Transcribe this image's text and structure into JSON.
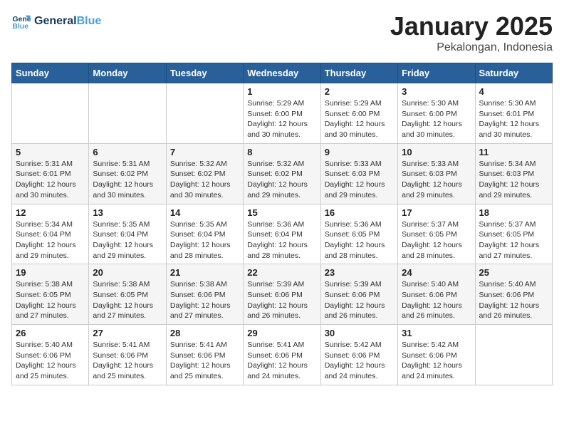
{
  "header": {
    "logo_line1": "General",
    "logo_line2": "Blue",
    "month": "January 2025",
    "location": "Pekalongan, Indonesia"
  },
  "weekdays": [
    "Sunday",
    "Monday",
    "Tuesday",
    "Wednesday",
    "Thursday",
    "Friday",
    "Saturday"
  ],
  "weeks": [
    [
      {
        "day": "",
        "info": ""
      },
      {
        "day": "",
        "info": ""
      },
      {
        "day": "",
        "info": ""
      },
      {
        "day": "1",
        "info": "Sunrise: 5:29 AM\nSunset: 6:00 PM\nDaylight: 12 hours\nand 30 minutes."
      },
      {
        "day": "2",
        "info": "Sunrise: 5:29 AM\nSunset: 6:00 PM\nDaylight: 12 hours\nand 30 minutes."
      },
      {
        "day": "3",
        "info": "Sunrise: 5:30 AM\nSunset: 6:00 PM\nDaylight: 12 hours\nand 30 minutes."
      },
      {
        "day": "4",
        "info": "Sunrise: 5:30 AM\nSunset: 6:01 PM\nDaylight: 12 hours\nand 30 minutes."
      }
    ],
    [
      {
        "day": "5",
        "info": "Sunrise: 5:31 AM\nSunset: 6:01 PM\nDaylight: 12 hours\nand 30 minutes."
      },
      {
        "day": "6",
        "info": "Sunrise: 5:31 AM\nSunset: 6:02 PM\nDaylight: 12 hours\nand 30 minutes."
      },
      {
        "day": "7",
        "info": "Sunrise: 5:32 AM\nSunset: 6:02 PM\nDaylight: 12 hours\nand 30 minutes."
      },
      {
        "day": "8",
        "info": "Sunrise: 5:32 AM\nSunset: 6:02 PM\nDaylight: 12 hours\nand 29 minutes."
      },
      {
        "day": "9",
        "info": "Sunrise: 5:33 AM\nSunset: 6:03 PM\nDaylight: 12 hours\nand 29 minutes."
      },
      {
        "day": "10",
        "info": "Sunrise: 5:33 AM\nSunset: 6:03 PM\nDaylight: 12 hours\nand 29 minutes."
      },
      {
        "day": "11",
        "info": "Sunrise: 5:34 AM\nSunset: 6:03 PM\nDaylight: 12 hours\nand 29 minutes."
      }
    ],
    [
      {
        "day": "12",
        "info": "Sunrise: 5:34 AM\nSunset: 6:04 PM\nDaylight: 12 hours\nand 29 minutes."
      },
      {
        "day": "13",
        "info": "Sunrise: 5:35 AM\nSunset: 6:04 PM\nDaylight: 12 hours\nand 29 minutes."
      },
      {
        "day": "14",
        "info": "Sunrise: 5:35 AM\nSunset: 6:04 PM\nDaylight: 12 hours\nand 28 minutes."
      },
      {
        "day": "15",
        "info": "Sunrise: 5:36 AM\nSunset: 6:04 PM\nDaylight: 12 hours\nand 28 minutes."
      },
      {
        "day": "16",
        "info": "Sunrise: 5:36 AM\nSunset: 6:05 PM\nDaylight: 12 hours\nand 28 minutes."
      },
      {
        "day": "17",
        "info": "Sunrise: 5:37 AM\nSunset: 6:05 PM\nDaylight: 12 hours\nand 28 minutes."
      },
      {
        "day": "18",
        "info": "Sunrise: 5:37 AM\nSunset: 6:05 PM\nDaylight: 12 hours\nand 27 minutes."
      }
    ],
    [
      {
        "day": "19",
        "info": "Sunrise: 5:38 AM\nSunset: 6:05 PM\nDaylight: 12 hours\nand 27 minutes."
      },
      {
        "day": "20",
        "info": "Sunrise: 5:38 AM\nSunset: 6:05 PM\nDaylight: 12 hours\nand 27 minutes."
      },
      {
        "day": "21",
        "info": "Sunrise: 5:38 AM\nSunset: 6:06 PM\nDaylight: 12 hours\nand 27 minutes."
      },
      {
        "day": "22",
        "info": "Sunrise: 5:39 AM\nSunset: 6:06 PM\nDaylight: 12 hours\nand 26 minutes."
      },
      {
        "day": "23",
        "info": "Sunrise: 5:39 AM\nSunset: 6:06 PM\nDaylight: 12 hours\nand 26 minutes."
      },
      {
        "day": "24",
        "info": "Sunrise: 5:40 AM\nSunset: 6:06 PM\nDaylight: 12 hours\nand 26 minutes."
      },
      {
        "day": "25",
        "info": "Sunrise: 5:40 AM\nSunset: 6:06 PM\nDaylight: 12 hours\nand 26 minutes."
      }
    ],
    [
      {
        "day": "26",
        "info": "Sunrise: 5:40 AM\nSunset: 6:06 PM\nDaylight: 12 hours\nand 25 minutes."
      },
      {
        "day": "27",
        "info": "Sunrise: 5:41 AM\nSunset: 6:06 PM\nDaylight: 12 hours\nand 25 minutes."
      },
      {
        "day": "28",
        "info": "Sunrise: 5:41 AM\nSunset: 6:06 PM\nDaylight: 12 hours\nand 25 minutes."
      },
      {
        "day": "29",
        "info": "Sunrise: 5:41 AM\nSunset: 6:06 PM\nDaylight: 12 hours\nand 24 minutes."
      },
      {
        "day": "30",
        "info": "Sunrise: 5:42 AM\nSunset: 6:06 PM\nDaylight: 12 hours\nand 24 minutes."
      },
      {
        "day": "31",
        "info": "Sunrise: 5:42 AM\nSunset: 6:06 PM\nDaylight: 12 hours\nand 24 minutes."
      },
      {
        "day": "",
        "info": ""
      }
    ]
  ]
}
